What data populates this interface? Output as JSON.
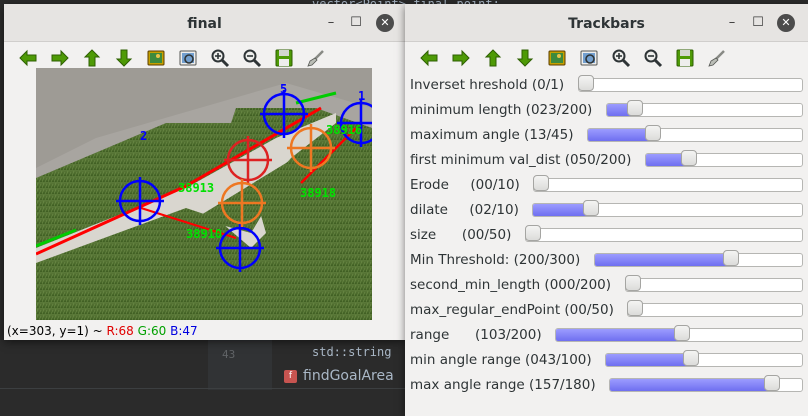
{
  "ide": {
    "code_top": "vector<Point> final point;",
    "line_number": "43",
    "code_line": "std::string",
    "breadcrumb_icon": "f",
    "breadcrumb_label": "findGoalArea"
  },
  "final_window": {
    "title": "final",
    "status": {
      "coords": "(x=303, y=1) ~ ",
      "r": "R:68",
      "g": "G:60",
      "b": "B:47"
    },
    "overlay_labels": {
      "top_left": "2",
      "blue_top": "5",
      "blue_right": "1",
      "green_1": "38916",
      "green_2": "38913",
      "green_3": "38918",
      "green_4": "38910"
    }
  },
  "toolbar": [
    {
      "name": "pan-left-icon"
    },
    {
      "name": "pan-right-icon"
    },
    {
      "name": "pan-up-icon"
    },
    {
      "name": "pan-down-icon"
    },
    {
      "name": "zoom-to-fit-icon"
    },
    {
      "name": "zoom-original-icon"
    },
    {
      "name": "zoom-in-icon"
    },
    {
      "name": "zoom-out-icon"
    },
    {
      "name": "save-icon"
    },
    {
      "name": "properties-icon"
    }
  ],
  "trackbars_window": {
    "title": "Trackbars",
    "sliders": [
      {
        "label": "Inverset hreshold (0/1)",
        "value": 0,
        "max": 1
      },
      {
        "label": "minimum length (023/200)",
        "value": 23,
        "max": 200
      },
      {
        "label": "maximum angle (13/45)",
        "value": 13,
        "max": 45
      },
      {
        "label": "first minimum val_dist (050/200)",
        "value": 50,
        "max": 200
      },
      {
        "label": "Erode     (00/10)",
        "value": 0,
        "max": 10
      },
      {
        "label": "dilate     (02/10)",
        "value": 2,
        "max": 10
      },
      {
        "label": "size      (00/50)",
        "value": 0,
        "max": 50
      },
      {
        "label": "Min Threshold: (200/300)",
        "value": 200,
        "max": 300
      },
      {
        "label": "second_min_length (000/200)",
        "value": 0,
        "max": 200
      },
      {
        "label": "max_regular_endPoint (00/50)",
        "value": 0,
        "max": 50
      },
      {
        "label": "range      (103/200)",
        "value": 103,
        "max": 200
      },
      {
        "label": "min angle range (043/100)",
        "value": 43,
        "max": 100
      },
      {
        "label": "max angle range (157/180)",
        "value": 157,
        "max": 180
      }
    ]
  },
  "colors": {
    "slider_fill": "#7b7bf5",
    "status_r": "#e00000",
    "status_g": "#00a000",
    "status_b": "#0000e0"
  }
}
